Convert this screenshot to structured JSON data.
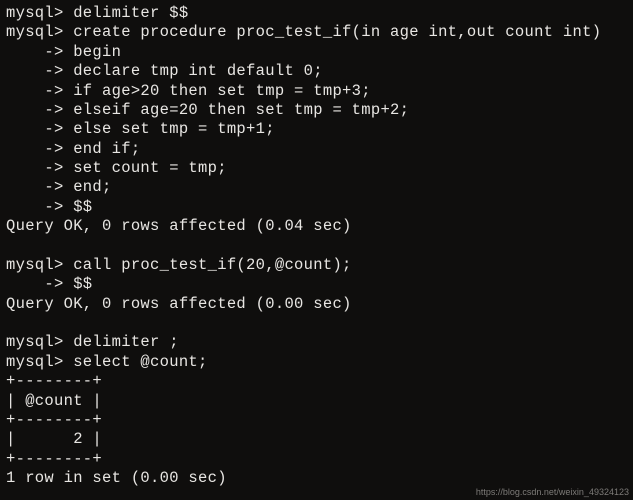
{
  "lines": [
    "mysql> delimiter $$",
    "mysql> create procedure proc_test_if(in age int,out count int)",
    "    -> begin",
    "    -> declare tmp int default 0;",
    "    -> if age>20 then set tmp = tmp+3;",
    "    -> elseif age=20 then set tmp = tmp+2;",
    "    -> else set tmp = tmp+1;",
    "    -> end if;",
    "    -> set count = tmp;",
    "    -> end;",
    "    -> $$",
    "Query OK, 0 rows affected (0.04 sec)",
    "",
    "mysql> call proc_test_if(20,@count);",
    "    -> $$",
    "Query OK, 0 rows affected (0.00 sec)",
    "",
    "mysql> delimiter ;",
    "mysql> select @count;",
    "+--------+",
    "| @count |",
    "+--------+",
    "|      2 |",
    "+--------+",
    "1 row in set (0.00 sec)"
  ],
  "watermark": "https://blog.csdn.net/weixin_49324123"
}
